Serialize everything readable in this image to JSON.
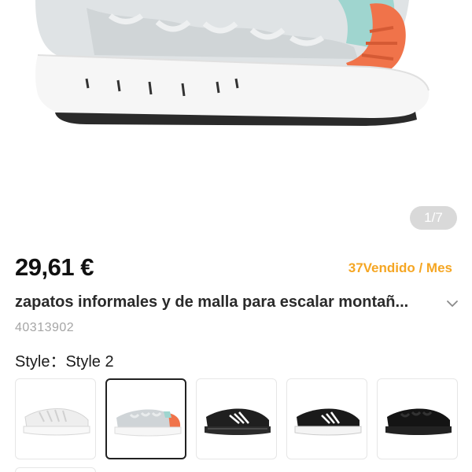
{
  "product": {
    "image_counter": "1/7",
    "price": "29,61 €",
    "sold_per_month": "37Vendido / Mes",
    "title": "zapatos informales y de malla para escalar montañ...",
    "sku": "40313902",
    "style_label": "Style：",
    "style_value": "Style 2"
  },
  "style_options": [
    {
      "name": "white-sneaker",
      "selected": false
    },
    {
      "name": "grey-orange-sneaker",
      "selected": true
    },
    {
      "name": "black-white-stripe-sneaker",
      "selected": false
    },
    {
      "name": "black-white-sole-sneaker",
      "selected": false
    },
    {
      "name": "all-black-sneaker",
      "selected": false
    }
  ],
  "colors": {
    "price_text": "#111111",
    "sold_accent": "#f5a623",
    "muted_text": "#a5a5a5",
    "counter_bg": "#d9d9d9",
    "selected_border": "#222222"
  }
}
